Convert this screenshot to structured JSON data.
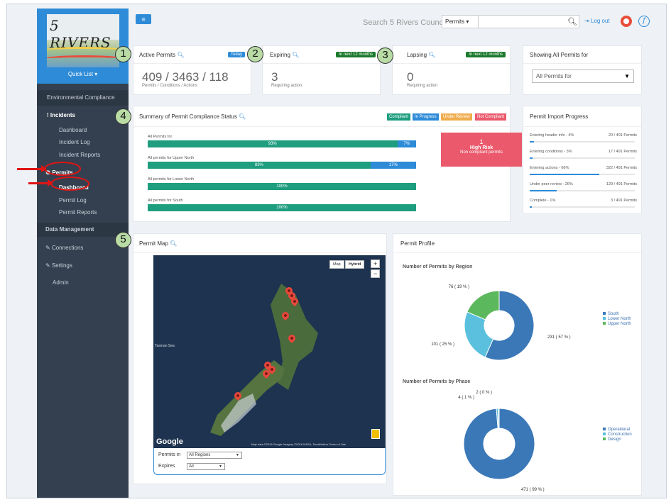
{
  "logo": {
    "brand": "5 RIVERS"
  },
  "sidebar": {
    "quick_list": "Quick List ▾",
    "env_compliance": "Environmental Compliance",
    "incidents": "! Incidents",
    "incident_items": [
      "Dashboard",
      "Incident Log",
      "Incident Reports"
    ],
    "permits": "Permits",
    "permit_items": [
      "Dashboard",
      "Permit Log",
      "Permit Reports"
    ],
    "data_management": "Data Management",
    "connections": "Connections",
    "settings": "Settings",
    "admin": "Admin"
  },
  "topbar": {
    "menu": "≡",
    "search_label": "Search 5 Rivers Council",
    "scope": "Permits ▾",
    "search_icon": "search-icon",
    "logout": "Log out"
  },
  "kpis": {
    "active": {
      "title": "Active Permits",
      "badge": "Today",
      "value": "409 / 3463 / 118",
      "sub": "Permits / Conditions / Actions",
      "num": "1"
    },
    "expiring": {
      "title": "Expiring",
      "badge": "In next 12 months",
      "value": "3",
      "sub": "Requiring action",
      "num": "2"
    },
    "lapsing": {
      "title": "Lapsing",
      "badge": "In next 12 months",
      "value": "0",
      "sub": "Requiring action",
      "num": "3"
    }
  },
  "showing": {
    "title": "Showing All Permits for",
    "select": "All Permits for"
  },
  "summary": {
    "num": "4",
    "title": "Summary of Permit Compliance Status",
    "legend": [
      "Compliant",
      "In Progress",
      "Under Review",
      "Not Compliant"
    ],
    "bars": [
      {
        "label": "All Permits for",
        "compliant": 93,
        "in_progress": 7,
        "compliant_text": "93%",
        "in_progress_text": "7%"
      },
      {
        "label": "All permits for Upper North",
        "compliant": 83,
        "in_progress": 17,
        "compliant_text": "83%",
        "in_progress_text": "17%"
      },
      {
        "label": "All permits for Lower North",
        "compliant": 100,
        "in_progress": 0,
        "compliant_text": "100%",
        "in_progress_text": ""
      },
      {
        "label": "All permits for South",
        "compliant": 100,
        "in_progress": 0,
        "compliant_text": "100%",
        "in_progress_text": ""
      }
    ],
    "high_risk": {
      "count": "1",
      "label": "High Risk",
      "sub": "Non compliant permits"
    }
  },
  "import": {
    "title": "Permit Import Progress",
    "rows": [
      {
        "label": "Entering header info - 4%",
        "count": "20 / 491 Permits",
        "pct": 4
      },
      {
        "label": "Entering conditions - 3%",
        "count": "17 / 491 Permits",
        "pct": 3
      },
      {
        "label": "Entering actions - 66%",
        "count": "322 / 491 Permits",
        "pct": 66
      },
      {
        "label": "Under peer review - 26%",
        "count": "129 / 491 Permits",
        "pct": 26
      },
      {
        "label": "Complete - 1%",
        "count": "3 / 491 Permits",
        "pct": 1
      }
    ]
  },
  "map": {
    "num": "5",
    "title": "Permit Map",
    "map_btn": "Map",
    "hybrid_btn": "Hybrid",
    "zoom_in": "+",
    "zoom_out": "−",
    "sea_label": "Tasman Sea",
    "google": "Google",
    "attribution": "Map data ©2016 Google Imagery ©2016 NASA, TerraMetrics   Terms of Use",
    "permits_in_label": "Permits in",
    "permits_in_value": "All Regions",
    "expires_label": "Expires",
    "expires_value": "All"
  },
  "profile": {
    "title": "Permit Profile",
    "region_title": "Number of Permits by Region",
    "phase_title": "Number of Permits by Phase"
  },
  "chart_data": [
    {
      "type": "pie",
      "title": "Number of Permits by Region",
      "categories": [
        "South",
        "Lower North",
        "Upper North"
      ],
      "values": [
        231,
        101,
        76
      ],
      "labels": [
        "231 ( 57 % )",
        "101 ( 25 % )",
        "76 ( 19 % )"
      ],
      "colors": [
        "#3a78b8",
        "#5bc0de",
        "#5cb85c"
      ],
      "legend": "right"
    },
    {
      "type": "pie",
      "title": "Number of Permits by Phase",
      "categories": [
        "Operational",
        "Construction",
        "Design"
      ],
      "values": [
        471,
        4,
        2
      ],
      "labels": [
        "471 ( 99 % )",
        "4 ( 1 % )",
        "2 ( 0 % )"
      ],
      "colors": [
        "#3a78b8",
        "#5bc0de",
        "#5cb85c"
      ],
      "legend": "right"
    }
  ],
  "colors": {
    "brand": "#2e8bd8",
    "compliant": "#1e9e7f",
    "in_progress": "#2e8bd8",
    "under_review": "#f0ad4e",
    "not_compliant": "#ea5a6c",
    "badge_blue": "#2e8bd8",
    "badge_green": "#1b7a2c"
  }
}
